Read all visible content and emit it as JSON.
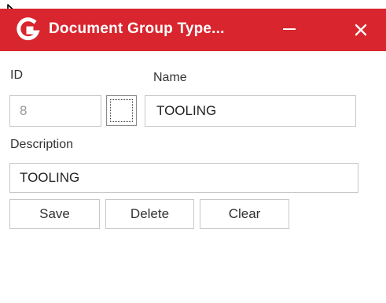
{
  "window": {
    "title": "Document Group Type...",
    "accent_color": "#d9252d"
  },
  "icons": {
    "logo": "app-logo-icon",
    "minimize": "minimize-icon",
    "close": "close-icon",
    "cursor": "mouse-cursor"
  },
  "form": {
    "id_label": "ID",
    "id_value": "8",
    "name_label": "Name",
    "name_value": "TOOLING",
    "description_label": "Description",
    "description_value": "TOOLING"
  },
  "buttons": {
    "save": "Save",
    "delete": "Delete",
    "clear": "Clear"
  }
}
